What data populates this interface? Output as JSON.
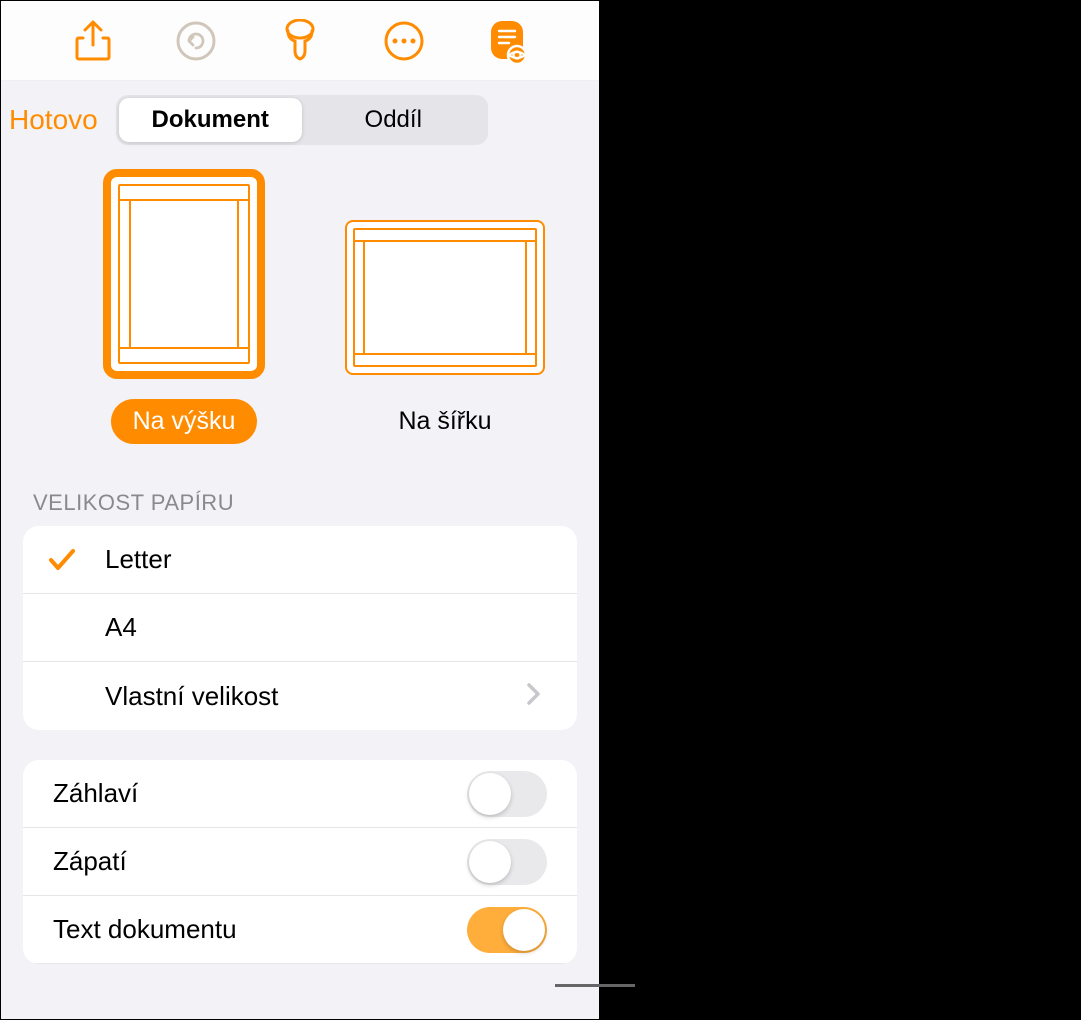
{
  "header": {
    "done": "Hotovo",
    "tabs": [
      "Dokument",
      "Oddíl"
    ]
  },
  "orientation": {
    "portrait": "Na výšku",
    "landscape": "Na šířku"
  },
  "paperSize": {
    "header": "VELIKOST PAPÍRU",
    "options": [
      "Letter",
      "A4",
      "Vlastní velikost"
    ]
  },
  "toggles": {
    "header": "Záhlaví",
    "footer": "Zápatí",
    "bodyText": "Text dokumentu"
  }
}
